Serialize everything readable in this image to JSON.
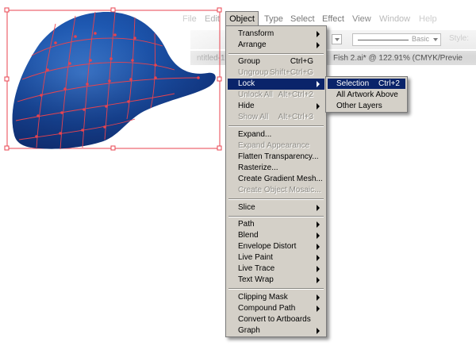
{
  "menubar": {
    "items": [
      {
        "label": "File"
      },
      {
        "label": "Edit"
      },
      {
        "label": "Object"
      },
      {
        "label": "Type"
      },
      {
        "label": "Select"
      },
      {
        "label": "Effect"
      },
      {
        "label": "View"
      },
      {
        "label": "Window"
      },
      {
        "label": "Help"
      }
    ]
  },
  "toolbar": {
    "stroke_style_label": "Basic",
    "style_label": "Style:"
  },
  "tabs": {
    "left_tab": "ntitled-1*",
    "active_tab": "Fish 2.ai* @ 122.91% (CMYK/Previe"
  },
  "object_menu": {
    "items": [
      {
        "label": "Transform",
        "shortcut": "",
        "submenu": true,
        "disabled": false
      },
      {
        "label": "Arrange",
        "shortcut": "",
        "submenu": true,
        "disabled": false
      },
      {
        "label": "Group",
        "shortcut": "Ctrl+G",
        "submenu": false,
        "disabled": false
      },
      {
        "label": "Ungroup",
        "shortcut": "Shift+Ctrl+G",
        "submenu": false,
        "disabled": true
      },
      {
        "label": "Lock",
        "shortcut": "",
        "submenu": true,
        "disabled": false,
        "highlighted": true
      },
      {
        "label": "Unlock All",
        "shortcut": "Alt+Ctrl+2",
        "submenu": false,
        "disabled": true
      },
      {
        "label": "Hide",
        "shortcut": "",
        "submenu": true,
        "disabled": false
      },
      {
        "label": "Show All",
        "shortcut": "Alt+Ctrl+3",
        "submenu": false,
        "disabled": true
      },
      {
        "label": "Expand...",
        "shortcut": "",
        "submenu": false,
        "disabled": false
      },
      {
        "label": "Expand Appearance",
        "shortcut": "",
        "submenu": false,
        "disabled": true
      },
      {
        "label": "Flatten Transparency...",
        "shortcut": "",
        "submenu": false,
        "disabled": false
      },
      {
        "label": "Rasterize...",
        "shortcut": "",
        "submenu": false,
        "disabled": false
      },
      {
        "label": "Create Gradient Mesh...",
        "shortcut": "",
        "submenu": false,
        "disabled": false
      },
      {
        "label": "Create Object Mosaic...",
        "shortcut": "",
        "submenu": false,
        "disabled": true
      },
      {
        "label": "Slice",
        "shortcut": "",
        "submenu": true,
        "disabled": false
      },
      {
        "label": "Path",
        "shortcut": "",
        "submenu": true,
        "disabled": false
      },
      {
        "label": "Blend",
        "shortcut": "",
        "submenu": true,
        "disabled": false
      },
      {
        "label": "Envelope Distort",
        "shortcut": "",
        "submenu": true,
        "disabled": false
      },
      {
        "label": "Live Paint",
        "shortcut": "",
        "submenu": true,
        "disabled": false
      },
      {
        "label": "Live Trace",
        "shortcut": "",
        "submenu": true,
        "disabled": false
      },
      {
        "label": "Text Wrap",
        "shortcut": "",
        "submenu": true,
        "disabled": false
      },
      {
        "label": "Clipping Mask",
        "shortcut": "",
        "submenu": true,
        "disabled": false
      },
      {
        "label": "Compound Path",
        "shortcut": "",
        "submenu": true,
        "disabled": false
      },
      {
        "label": "Convert to Artboards",
        "shortcut": "",
        "submenu": false,
        "disabled": false
      },
      {
        "label": "Graph",
        "shortcut": "",
        "submenu": true,
        "disabled": false
      }
    ]
  },
  "lock_submenu": {
    "items": [
      {
        "label": "Selection",
        "shortcut": "Ctrl+2",
        "highlighted": true
      },
      {
        "label": "All Artwork Above",
        "shortcut": ""
      },
      {
        "label": "Other Layers",
        "shortcut": ""
      }
    ]
  },
  "colors": {
    "menu_bg": "#d4d0c8",
    "highlight": "#0a246a",
    "mesh_line": "#e8434f",
    "artwork_blue": "#1f5bb5"
  },
  "icons": {
    "submenu_arrow": "submenu-arrow-icon",
    "dropdown_arrow": "dropdown-arrow-icon"
  }
}
